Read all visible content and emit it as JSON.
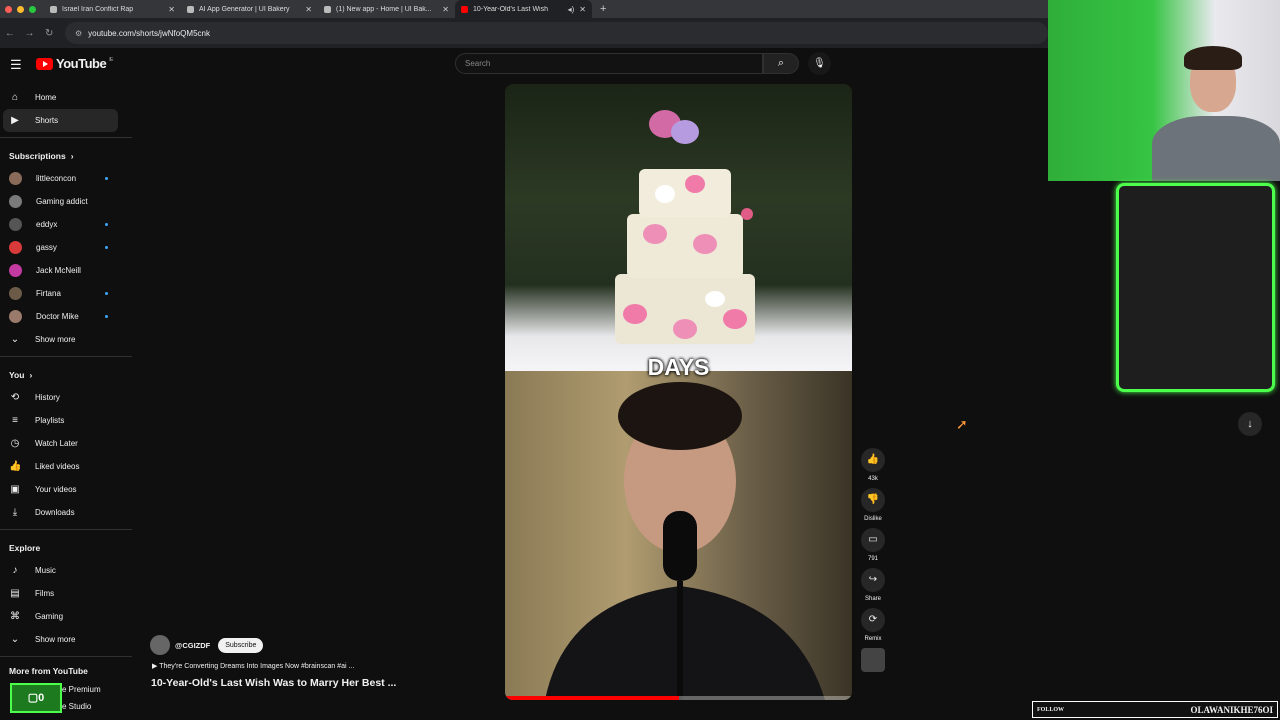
{
  "browser": {
    "tabs": [
      {
        "title": "Israel Iran Conflict Rap"
      },
      {
        "title": "AI App Generator | UI Bakery"
      },
      {
        "title": "(1) New app - Home | UI Bak..."
      },
      {
        "title": "10-Year-Old's Last Wish"
      }
    ],
    "url": "youtube.com/shorts/jwNfoQM5cnk"
  },
  "youtube": {
    "logo_text": "YouTube",
    "logo_region": "IE",
    "search_placeholder": "Search"
  },
  "sidebar": {
    "main": [
      {
        "label": "Home",
        "icon": "home-icon"
      },
      {
        "label": "Shorts",
        "icon": "shorts-icon"
      }
    ],
    "subscriptions_heading": "Subscriptions",
    "subscriptions": [
      {
        "label": "littleconcon",
        "color": "#8a6b5a",
        "new": true
      },
      {
        "label": "Gaming addict",
        "color": "#7a7a7a",
        "new": false
      },
      {
        "label": "eddyx",
        "color": "#555555",
        "new": true
      },
      {
        "label": "gassy",
        "color": "#d83a3a",
        "new": true
      },
      {
        "label": "Jack McNeill",
        "color": "#c43aa0",
        "new": false
      },
      {
        "label": "Firtana",
        "color": "#6b5a48",
        "new": true
      },
      {
        "label": "Doctor Mike",
        "color": "#9a7a6a",
        "new": true
      }
    ],
    "show_more": "Show more",
    "you_heading": "You",
    "you": [
      {
        "label": "History",
        "icon": "history-icon"
      },
      {
        "label": "Playlists",
        "icon": "playlists-icon"
      },
      {
        "label": "Watch Later",
        "icon": "watch-later-icon"
      },
      {
        "label": "Liked videos",
        "icon": "liked-icon"
      },
      {
        "label": "Your videos",
        "icon": "your-videos-icon"
      },
      {
        "label": "Downloads",
        "icon": "downloads-icon"
      }
    ],
    "explore_heading": "Explore",
    "explore": [
      {
        "label": "Music",
        "icon": "music-icon"
      },
      {
        "label": "Films",
        "icon": "films-icon"
      },
      {
        "label": "Gaming",
        "icon": "gaming-icon"
      }
    ],
    "show_more_2": "Show more",
    "more_heading": "More from YouTube",
    "more": [
      {
        "label": "YouTube Premium"
      },
      {
        "label": "YouTube Studio"
      }
    ]
  },
  "short": {
    "overlay_text": "DAYS",
    "progress_fraction": 0.5,
    "channel": "@CGIZDF",
    "subscribe": "Subscribe",
    "description": "They're Converting Dreams Into Images Now #brainscan #ai ...",
    "title": "10-Year-Old's Last Wish Was to Marry Her Best ...",
    "actions": {
      "likes": "43k",
      "dislike": "Dislike",
      "comments": "791",
      "share": "Share",
      "remix": "Remix"
    }
  },
  "overlay": {
    "follow_label": "FOLLOW",
    "follow_name": "OLAWANIKHE76OI",
    "counter": "0"
  }
}
